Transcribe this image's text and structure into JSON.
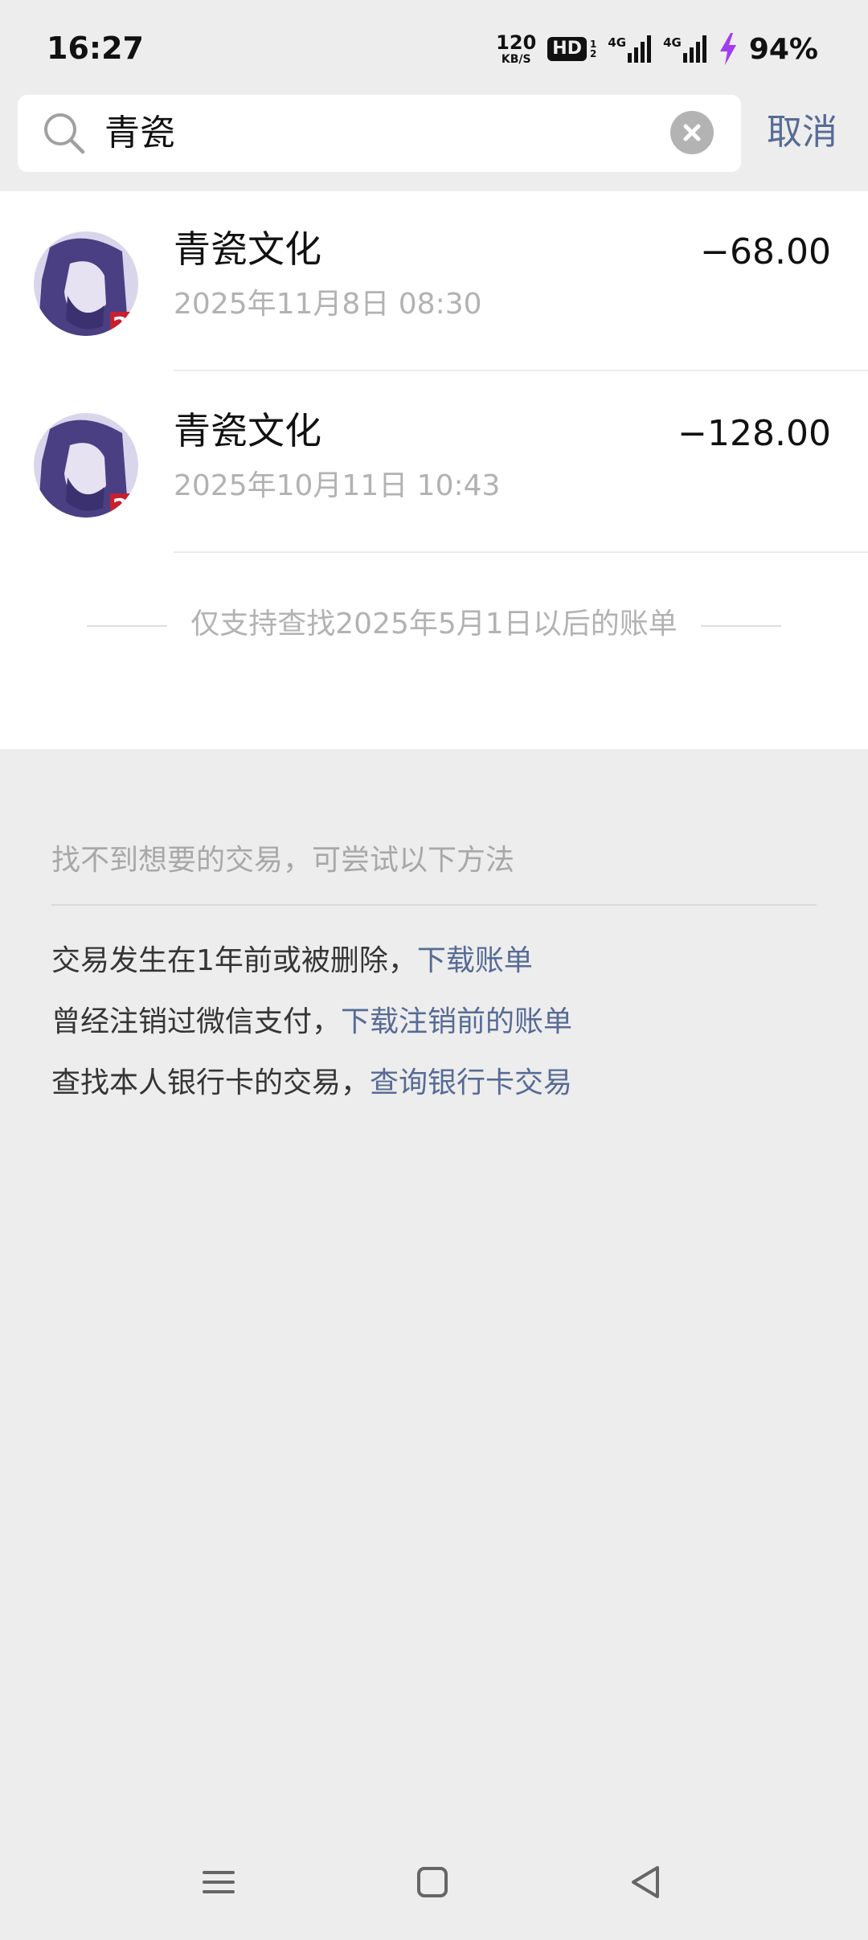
{
  "status_bar": {
    "time": "16:27",
    "speed_value": "120",
    "speed_unit": "KB/S",
    "hd_label": "HD",
    "hd_sub_top": "1",
    "hd_sub_bottom": "2",
    "network_1": "4G",
    "network_2": "4G",
    "battery": "94%"
  },
  "search": {
    "query": "青瓷",
    "cancel_label": "取消"
  },
  "results": [
    {
      "title": "青瓷文化",
      "date": "2025年11月8日 08:30",
      "amount": "−68.00"
    },
    {
      "title": "青瓷文化",
      "date": "2025年10月11日 10:43",
      "amount": "−128.00"
    }
  ],
  "notice": "仅支持查找2025年5月1日以后的账单",
  "help": {
    "title": "找不到想要的交易，可尝试以下方法",
    "lines": [
      {
        "text": "交易发生在1年前或被删除，",
        "link": "下载账单"
      },
      {
        "text": "曾经注销过微信支付，",
        "link": "下载注销前的账单"
      },
      {
        "text": "查找本人银行卡的交易，",
        "link": "查询银行卡交易"
      }
    ]
  },
  "colors": {
    "link": "#576b95",
    "background": "#ededed",
    "muted": "#b2b2b2"
  },
  "icons": [
    "search-icon",
    "clear-icon",
    "menu-icon",
    "home-icon",
    "back-icon"
  ]
}
